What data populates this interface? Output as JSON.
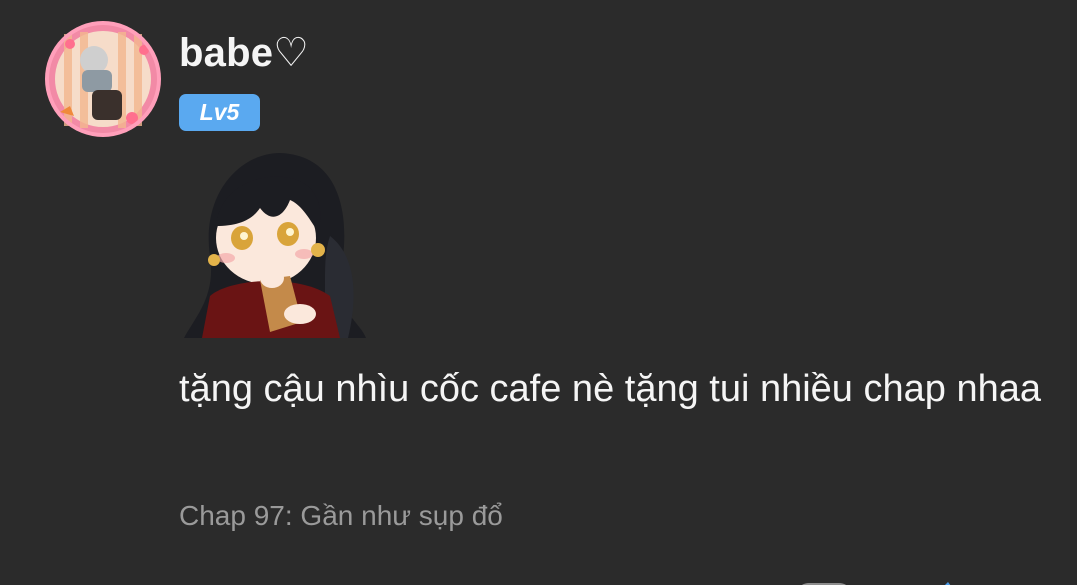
{
  "comment": {
    "username": "babe♡",
    "level_badge": "Lv5",
    "message": "tặng cậu nhìu cốc cafe nè tặng tui nhiều chap nhaa",
    "chapter": "Chap 97: Gần như sụp đổ"
  },
  "icons": {
    "avatar": "user-avatar",
    "sticker": "anime-girl-sticker",
    "reply": "reply-icon",
    "report": "flag-icon",
    "like": "like-icon"
  },
  "colors": {
    "background": "#2b2b2b",
    "badge": "#5aa9f0",
    "secondary_text": "#9a9a9a"
  }
}
